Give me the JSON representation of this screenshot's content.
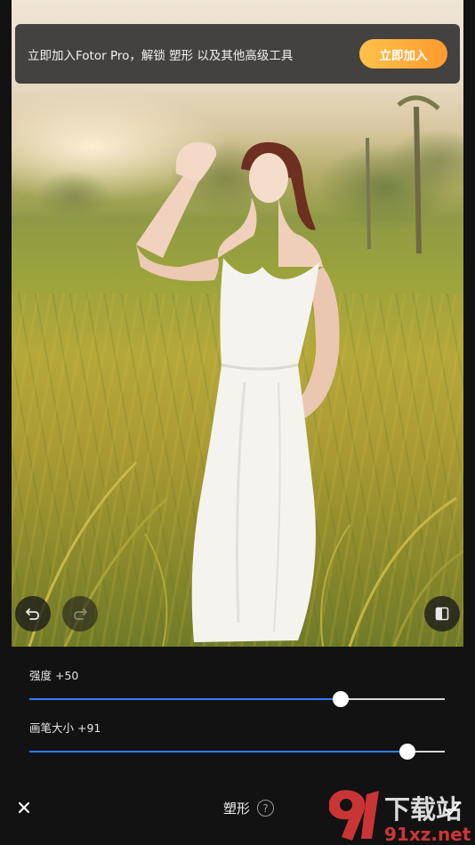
{
  "banner": {
    "message": "立即加入Fotor Pro，解锁 塑形 以及其他高级工具",
    "join_label": "立即加入"
  },
  "sliders": [
    {
      "label": "强度 +50",
      "value": 50,
      "min": -100,
      "max": 100
    },
    {
      "label": "画笔大小 +91",
      "value": 91,
      "min": 0,
      "max": 100
    }
  ],
  "bottom_bar": {
    "title": "塑形",
    "help_label": "?"
  },
  "icons": {
    "undo": "undo-icon",
    "redo": "redo-icon",
    "compare": "compare-icon",
    "close": "close-icon",
    "confirm": "check-icon",
    "help": "help-icon"
  },
  "watermark": {
    "top_text": "下载站",
    "bottom_text": "91xz.net"
  },
  "colors": {
    "accent": "#2f7cf6",
    "join_gradient_start": "#ffc24a",
    "join_gradient_end": "#ff9a2e",
    "background": "#121212"
  }
}
